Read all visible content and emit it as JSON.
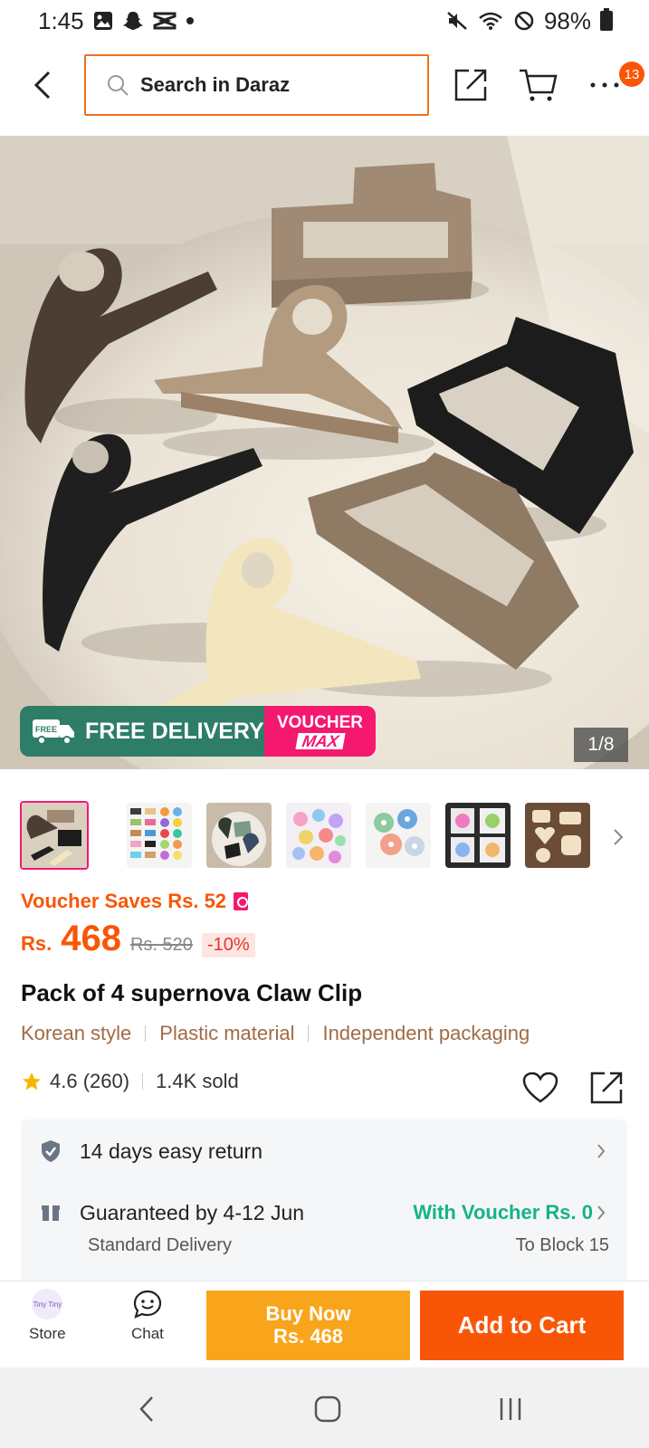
{
  "status_bar": {
    "time": "1:45",
    "battery": "98%",
    "icons": [
      "gallery-icon",
      "snapchat-icon",
      "capcut-icon",
      "dot-icon",
      "mute-icon",
      "wifi-icon",
      "no-disturb-icon",
      "battery-icon"
    ]
  },
  "header": {
    "search_placeholder": "Search in Daraz",
    "cart_badge": "13",
    "icons": [
      "back-icon",
      "search-icon",
      "share-icon",
      "cart-icon",
      "more-icon"
    ]
  },
  "gallery": {
    "promo_free": "FREE DELIVERY",
    "promo_free_small": "FREE",
    "promo_voucher_1": "VOUCHER",
    "promo_voucher_2": "MAX",
    "pager": "1/8",
    "thumbnail_count": 7
  },
  "price": {
    "voucher_saves": "Voucher Saves Rs. 52",
    "currency": "Rs.",
    "current": "468",
    "original": "Rs. 520",
    "discount": "-10%"
  },
  "product": {
    "title": "Pack of 4 supernova Claw Clip",
    "tags": [
      "Korean style",
      "Plastic material",
      "Independent packaging"
    ],
    "rating": "4.6 (260)",
    "sold": "1.4K sold"
  },
  "service": {
    "return": "14 days easy return",
    "guarantee": "Guaranteed by 4-12 Jun",
    "delivery_type": "Standard Delivery",
    "voucher_delivery": "With Voucher Rs. 0",
    "destination": "To Block 15"
  },
  "actions": {
    "store": "Store",
    "store_logo_text": "Tiny Tiny",
    "chat": "Chat",
    "buy_now_line1": "Buy Now",
    "buy_now_line2": "Rs. 468",
    "add_to_cart": "Add to Cart"
  },
  "colors": {
    "brand_orange": "#f85606",
    "buy_now": "#f9a51b",
    "voucher_pink": "#f5186f",
    "free_delivery_green": "#2e7d66",
    "voucher_green": "#15b389"
  }
}
